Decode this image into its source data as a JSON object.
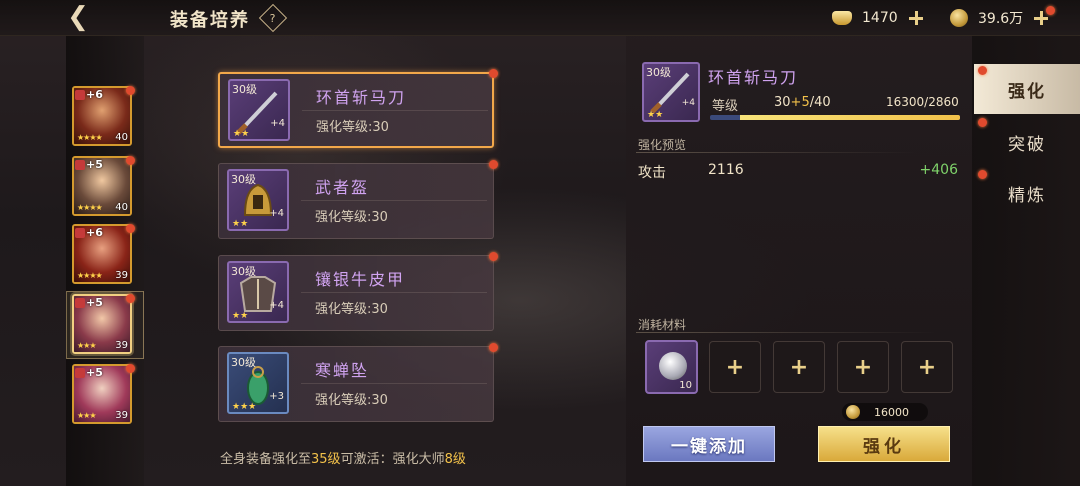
{
  "header": {
    "back_icon": "back-arrow-icon",
    "title": "装备培养",
    "help_icon": "question-diamond-icon",
    "ingot": "1470",
    "coins": "39.6万"
  },
  "heroes": [
    {
      "plus": "+6",
      "level": "40",
      "stars": "★★★★",
      "selected": false
    },
    {
      "plus": "+5",
      "level": "40",
      "stars": "★★★★",
      "selected": false
    },
    {
      "plus": "+6",
      "level": "39",
      "stars": "★★★★",
      "selected": false
    },
    {
      "plus": "+5",
      "level": "39",
      "stars": "★★★",
      "selected": true
    },
    {
      "plus": "+5",
      "level": "39",
      "stars": "★★★",
      "selected": false
    }
  ],
  "equipment": [
    {
      "level_tag": "30级",
      "name": "环首斩马刀",
      "enh_label": "强化等级:30",
      "plus": "+4",
      "stars": "★★",
      "selected": true
    },
    {
      "level_tag": "30级",
      "name": "武者盔",
      "enh_label": "强化等级:30",
      "plus": "+4",
      "stars": "★★",
      "selected": false
    },
    {
      "level_tag": "30级",
      "name": "镶银牛皮甲",
      "enh_label": "强化等级:30",
      "plus": "+4",
      "stars": "★★",
      "selected": false
    },
    {
      "level_tag": "30级",
      "name": "寒蝉坠",
      "enh_label": "强化等级:30",
      "plus": "+3",
      "stars": "★★★",
      "selected": false
    }
  ],
  "footer": {
    "pre": "全身装备强化至",
    "level": "35级",
    "mid": "可激活：强化大师",
    "master": "8级"
  },
  "detail": {
    "level_tag": "30级",
    "plus": "+4",
    "stars": "★★",
    "name": "环首斩马刀",
    "level_label": "等级",
    "level_cur": "30",
    "level_plus": "+5",
    "level_max": "/40",
    "exp_text": "16300/2860",
    "exp_fraction": 1.0,
    "preview_label": "强化预览",
    "attr_name": "攻击",
    "attr_value": "2116",
    "attr_inc": "+406",
    "materials_label": "消耗材料",
    "material_count": "10",
    "cost": "16000",
    "btn_add": "一键添加",
    "btn_enhance": "强化"
  },
  "tabs": [
    "强化",
    "突破",
    "精炼"
  ]
}
